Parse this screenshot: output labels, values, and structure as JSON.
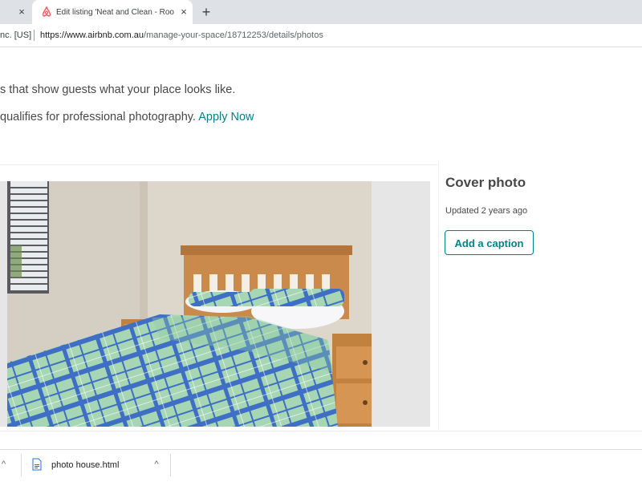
{
  "browser": {
    "inactive_tab_close": "×",
    "active_tab": {
      "title": "Edit listing 'Neat and Clean - Roo",
      "close": "×",
      "favicon": "airbnb-logo-icon"
    },
    "new_tab": "+",
    "address": {
      "cert_label": "nc. [US]",
      "url_host": "https://www.airbnb.com.au",
      "url_path": "/manage-your-space/18712253/details/photos"
    }
  },
  "page": {
    "intro_line_1": "s that show guests what your place looks like.",
    "intro_line_2_prefix": "qualifies for professional photography.",
    "apply_link": "Apply Now",
    "cover": {
      "title": "Cover photo",
      "updated": "Updated 2 years ago",
      "caption_button": "Add a caption"
    },
    "photo_alt": "bedroom-photo"
  },
  "downloads": {
    "left_chevron": "^",
    "file_name": "photo house.html",
    "file_chevron": "^"
  },
  "colors": {
    "accent_teal": "#008489",
    "text_dark": "#484848",
    "tab_strip": "#dee1e6",
    "airbnb_red": "#ff5a5f"
  }
}
